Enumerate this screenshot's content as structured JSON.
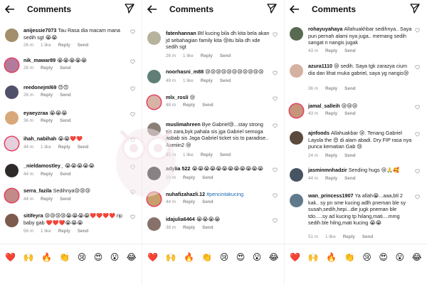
{
  "header": {
    "title": "Comments"
  },
  "panels": [
    {
      "comments": [
        {
          "user": "anijessie7073",
          "text": "Tau Rasa dia macam mana sedih sgt 😭😭",
          "time": "26 m",
          "likes": "1 like",
          "reply": "Reply",
          "send": "Send",
          "avatar_color": "#a38f6b"
        },
        {
          "user": "nik_mawar89",
          "text": "😭😭😭😭😭",
          "time": "26 m",
          "likes": "",
          "reply": "Reply",
          "send": "Send",
          "avatar_color": "#b47a9c"
        },
        {
          "user": "reedonejml69",
          "text": "😞😞",
          "time": "26 m",
          "likes": "",
          "reply": "Reply",
          "send": "Send",
          "avatar_color": "#50506a"
        },
        {
          "user": "eyaeyzraa",
          "text": "😭😭😭",
          "time": "36 m",
          "likes": "",
          "reply": "Reply",
          "send": "Send",
          "avatar_color": "#d9a87a"
        },
        {
          "user": "ihah_nabihah",
          "text": "😭😭❤️❤️",
          "time": "44 m",
          "likes": "1 like",
          "reply": "Reply",
          "send": "Send",
          "avatar_color": "#e5cfdc"
        },
        {
          "user": "_nieldamostley_",
          "text": "😭😭😭😭😭",
          "time": "44 m",
          "likes": "",
          "reply": "Reply",
          "send": "Send",
          "avatar_color": "#2e2a2a"
        },
        {
          "user": "serra_fazila",
          "text": "Sedihnya😢😢😢",
          "time": "44 m",
          "likes": "",
          "reply": "Reply",
          "send": "Send",
          "avatar_color": "#c28a88"
        },
        {
          "user": "sitifeyra",
          "text": "😢😢😢😢😭😭😭😭❤️❤️❤️❤️ rip baby gab ❤️❤️❤️😭😭😭",
          "time": "56 m",
          "likes": "1 like",
          "reply": "Reply",
          "send": "Send",
          "avatar_color": "#7d5a4d"
        }
      ]
    },
    {
      "comments": [
        {
          "user": "fatenhannan",
          "text": "Btl kucing bila dh kita bela akan jd sebahagian family kita 😢itu bila dh xde sedih sgt",
          "time": "26 m",
          "likes": "1 like",
          "reply": "Reply",
          "send": "Send",
          "avatar_color": "#b7b29c"
        },
        {
          "user": "noorhasni_m88",
          "text": "😢😢😢😢😢😢😢😢😢😢😢",
          "time": "49 m",
          "likes": "1 like",
          "reply": "Reply",
          "send": "Send",
          "avatar_color": "#5f7e76"
        },
        {
          "user": "mlx_rosli",
          "text": "😢",
          "time": "48 m",
          "likes": "",
          "reply": "Reply",
          "send": "Send",
          "avatar_color": "#d8b4a6"
        },
        {
          "user": "muslimahreen",
          "text": "Bye Gabriel😢...stay strong sis zara,byk pahala sis jga Gabriel semoga asbab sis Jaga Gabriel ticket sis to paradise.. Aamiin2 😢",
          "time": "35 m",
          "likes": "1 like",
          "reply": "Reply",
          "send": "Send",
          "avatar_color": "#8a7f76"
        },
        {
          "user": "adylia 522",
          "text": "😭😭😭😭😭😭😭😭😭😭😭😭",
          "time": "29 m",
          "likes": "",
          "reply": "Reply",
          "send": "Send",
          "avatar_color": "#1b1b1b"
        },
        {
          "user": "nuhafizahazli.12",
          "text": "#pencintakucing",
          "time": "44 m",
          "likes": "",
          "reply": "Reply",
          "send": "Send",
          "avatar_color": "#c9a06b"
        },
        {
          "user": "idajulia6464",
          "text": "😭😭😭😭",
          "time": "38 m",
          "likes": "",
          "reply": "Reply",
          "send": "Send",
          "avatar_color": "#86726a"
        }
      ]
    },
    {
      "comments": [
        {
          "user": "rohayuyahaya",
          "text": "Allahuakhbar sedihnya.. Saya pun pernah alami nya juga.. memang sedih sangat n nangis jugak",
          "time": "43 m",
          "likes": "",
          "reply": "Reply",
          "send": "Send",
          "avatar_color": "#586b52"
        },
        {
          "user": "azura1110",
          "text": "😢 sedih. Saya tgk zarazya cium dia dan lihat muka gabriel, saya yg nangis😢",
          "time": "36 m",
          "likes": "",
          "reply": "Reply",
          "send": "Send",
          "avatar_color": "#d6b1a2"
        },
        {
          "user": "jamal_salleih",
          "text": "😢😢😢",
          "time": "43 m",
          "likes": "",
          "reply": "Reply",
          "send": "Send",
          "avatar_color": "#c6957a"
        },
        {
          "user": "ajnfoods",
          "text": "Allahuakbar 😢. Tenang Gabriel Layola the 😍 di alam abadi. Dry FIP rasa nya punca kematian Gab 😢",
          "time": "24 m",
          "likes": "",
          "reply": "Reply",
          "send": "Send",
          "avatar_color": "#5a4a3d"
        },
        {
          "user": "jasminmnhadzir",
          "text": "Sending hugs 😢🙏🥰",
          "time": "44 m",
          "likes": "",
          "reply": "Reply",
          "send": "Send",
          "avatar_color": "#465462"
        },
        {
          "user": "wan_princess1907",
          "text": "Ya allah😭...aaa,btl 2 kak.. sy pn sme kucing adlh pneman ble sy susah,sedih,hepi...die jugk pneman ble tdo.....sy ad kucing tp hilang,mati....mmg sedih ble hilng,mati kucing 😭😭",
          "time": "51 m",
          "likes": "1 like",
          "reply": "Reply",
          "send": "Send",
          "avatar_color": "#607a8c"
        }
      ]
    }
  ],
  "emoji_bar": [
    "❤️",
    "🙌",
    "🔥",
    "👏",
    "😢",
    "😍",
    "😮",
    "😂"
  ]
}
